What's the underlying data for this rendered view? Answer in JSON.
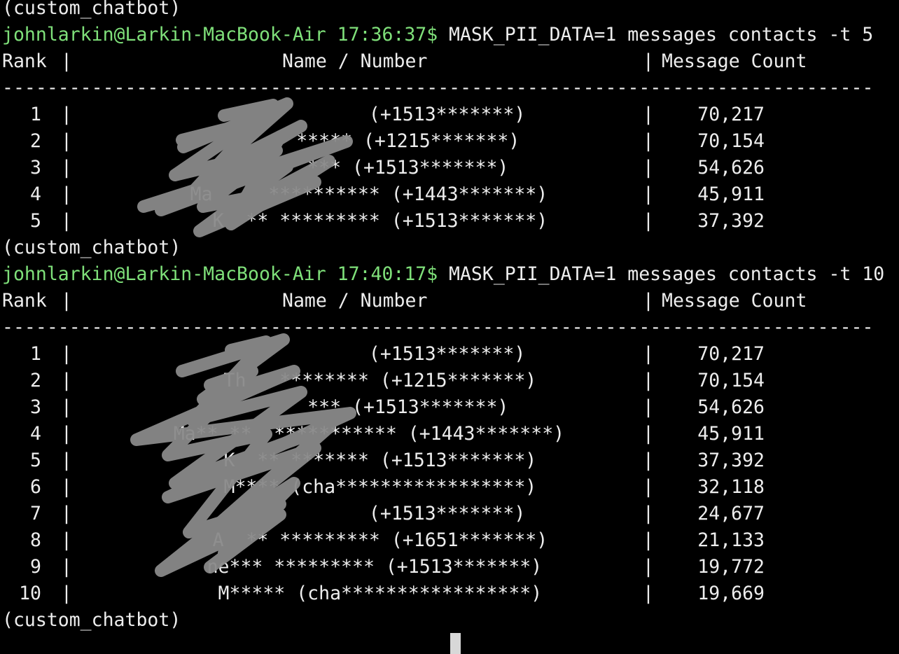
{
  "terminal": {
    "lines": [
      {
        "type": "env",
        "text": "(custom_chatbot)"
      },
      {
        "type": "prompt",
        "host": "johnlarkin@Larkin-MacBook-Air 17:36:37$",
        "command": "MASK_PII_DATA=1 messages contacts -t 5"
      },
      {
        "type": "header",
        "rank": "Rank",
        "sep": "|",
        "name": "Name / Number",
        "count": "Message Count"
      },
      {
        "type": "divider",
        "text": "------------------------------------------------------------------------------"
      },
      {
        "type": "row",
        "rank": "1",
        "sep": "|",
        "name": "                 (+1513*******)",
        "count": "70,217"
      },
      {
        "type": "row",
        "rank": "2",
        "sep": "|",
        "name": "          ***** (+1215*******)",
        "count": "70,154"
      },
      {
        "type": "row",
        "rank": "3",
        "sep": "|",
        "name": "          *** (+1513*******)",
        "count": "54,626"
      },
      {
        "type": "row",
        "rank": "4",
        "sep": "|",
        "name": "   Ma     ********** (+1443*******)",
        "count": "45,911"
      },
      {
        "type": "row",
        "rank": "5",
        "sep": "|",
        "name": "     K  ** ********* (+1513*******)",
        "count": "37,392"
      },
      {
        "type": "env",
        "text": "(custom_chatbot)"
      },
      {
        "type": "prompt",
        "host": "johnlarkin@Larkin-MacBook-Air 17:40:17$",
        "command": "MASK_PII_DATA=1 messages contacts -t 10"
      },
      {
        "type": "header",
        "rank": "Rank",
        "sep": "|",
        "name": "Name / Number",
        "count": "Message Count"
      },
      {
        "type": "divider",
        "text": "------------------------------------------------------------------------------"
      },
      {
        "type": "row",
        "rank": "1",
        "sep": "|",
        "name": "                 (+1513*******)",
        "count": "70,217"
      },
      {
        "type": "row",
        "rank": "2",
        "sep": "|",
        "name": "     Th   ******** (+1215*******)",
        "count": "70,154"
      },
      {
        "type": "row",
        "rank": "3",
        "sep": "|",
        "name": "          *** (+1513*******)",
        "count": "54,626"
      },
      {
        "type": "row",
        "rank": "4",
        "sep": "|",
        "name": "   Ma** **  *********** (+1443*******)",
        "count": "45,911"
      },
      {
        "type": "row",
        "rank": "5",
        "sep": "|",
        "name": "     K  ** ******* (+1513*******)",
        "count": "37,392"
      },
      {
        "type": "row",
        "rank": "6",
        "sep": "|",
        "name": "     M**** (cha*****************)",
        "count": "32,118"
      },
      {
        "type": "row",
        "rank": "7",
        "sep": "|",
        "name": "                 (+1513*******)",
        "count": "24,677"
      },
      {
        "type": "row",
        "rank": "8",
        "sep": "|",
        "name": "     A  ** ********* (+1651*******)",
        "count": "21,133"
      },
      {
        "type": "row",
        "rank": "9",
        "sep": "|",
        "name": "    ne*** ********* (+1513*******)",
        "count": "19,772"
      },
      {
        "type": "row",
        "rank": "10",
        "sep": "|",
        "name": "     M***** (cha*****************)",
        "count": "19,669"
      },
      {
        "type": "env",
        "text": "(custom_chatbot)"
      }
    ]
  },
  "colors": {
    "background": "#000000",
    "text": "#ededed",
    "prompt": "#7fe07a",
    "redaction": "#8a8a8a",
    "cursor": "#d8d8d8"
  }
}
